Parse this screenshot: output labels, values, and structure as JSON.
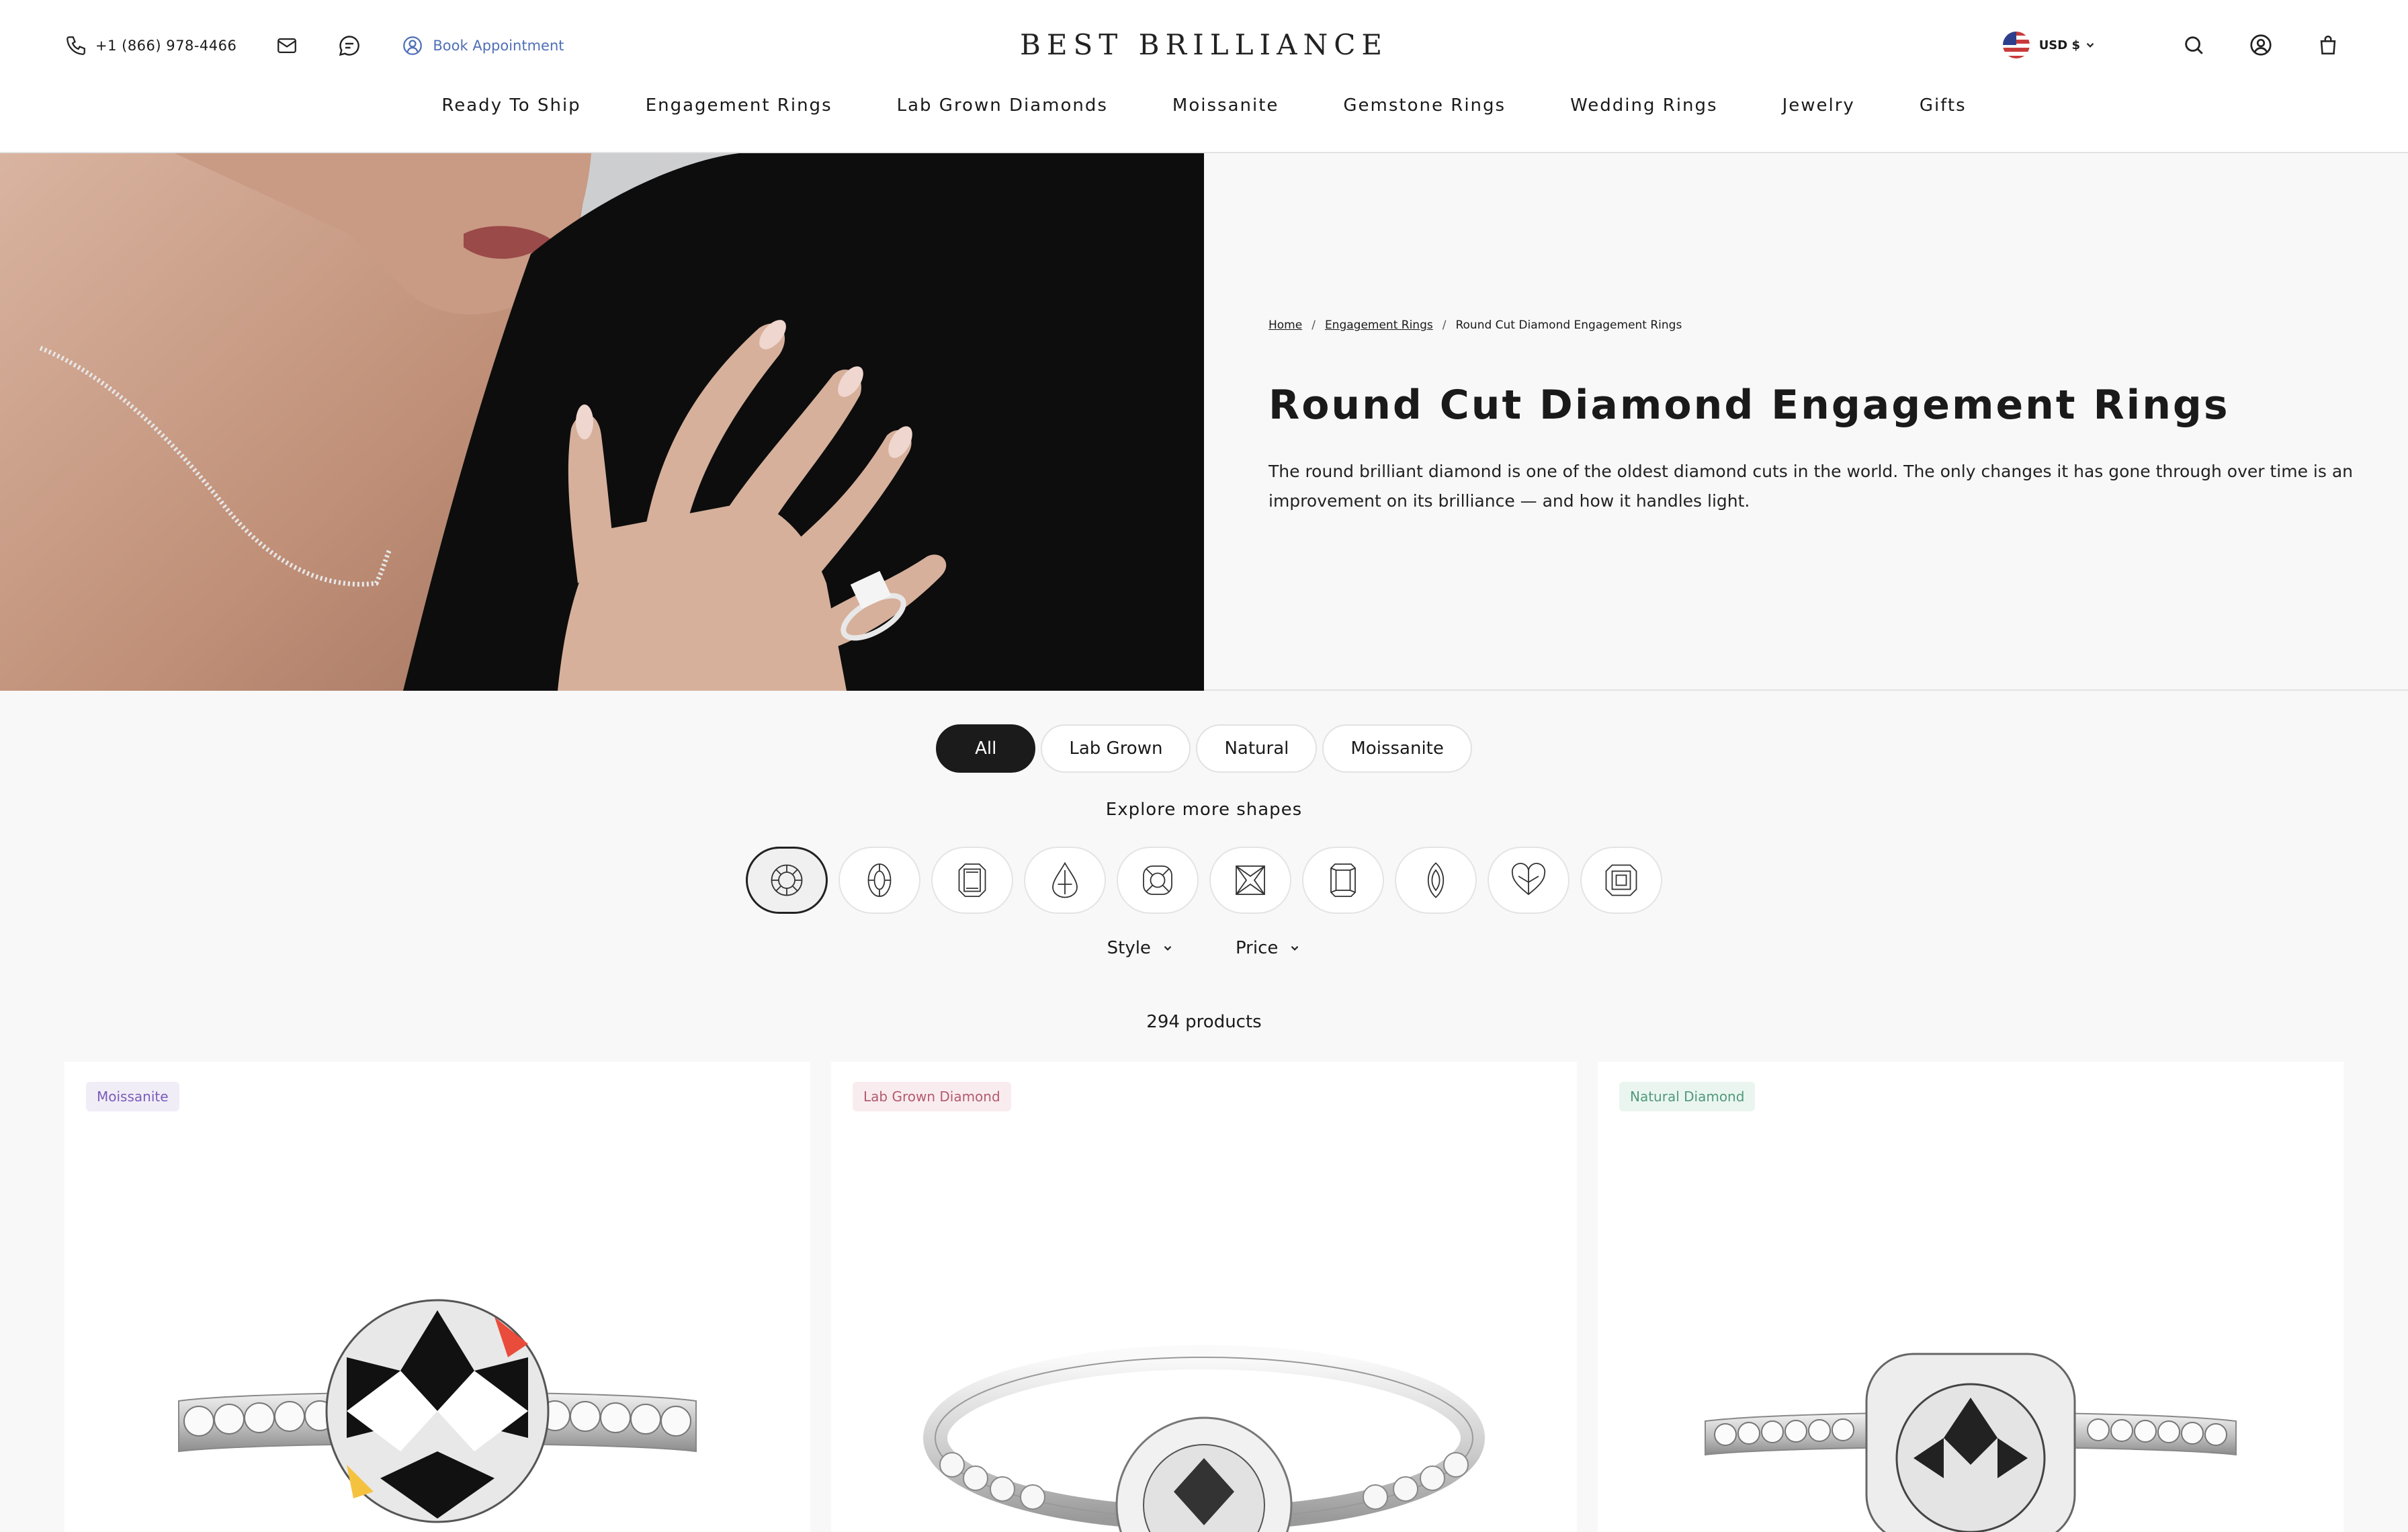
{
  "header": {
    "phone": "+1 (866) 978-4466",
    "book_appointment": "Book Appointment",
    "logo": "BEST BRILLIANCE",
    "currency": "USD $",
    "icons": [
      "phone-icon",
      "mail-icon",
      "chat-icon",
      "calendar-icon",
      "us-flag-icon",
      "chevron-down-icon",
      "search-icon",
      "account-icon",
      "bag-icon"
    ]
  },
  "nav": {
    "items": [
      "Ready To Ship",
      "Engagement Rings",
      "Lab Grown Diamonds",
      "Moissanite",
      "Gemstone Rings",
      "Wedding Rings",
      "Jewelry",
      "Gifts"
    ]
  },
  "hero": {
    "breadcrumb": [
      "Home",
      "Engagement Rings",
      "Round Cut Diamond Engagement Rings"
    ],
    "title": "Round Cut Diamond Engagement Rings",
    "description": "The round brilliant diamond is one of the oldest diamond cuts in the world. The only changes it has gone through over time is an improvement on its brilliance — and how it handles light."
  },
  "filters": {
    "tabs": [
      "All",
      "Lab Grown",
      "Natural",
      "Moissanite"
    ],
    "active_tab": "All",
    "shapes_title": "Explore more shapes",
    "shapes": [
      "round",
      "oval",
      "emerald",
      "pear",
      "cushion",
      "princess",
      "radiant",
      "marquise",
      "heart",
      "asscher"
    ],
    "active_shape": "round",
    "dropdowns": [
      "Style",
      "Price"
    ],
    "product_count": "294 products"
  },
  "products": [
    {
      "badge": "Moissanite",
      "badge_color": "#7a5cb8",
      "badge_bg": "#f1edf7"
    },
    {
      "badge": "Lab Grown Diamond",
      "badge_color": "#b35a6e",
      "badge_bg": "#f9ecef"
    },
    {
      "badge": "Natural Diamond",
      "badge_color": "#4f9a7a",
      "badge_bg": "#ebf5f0"
    }
  ],
  "colors": {
    "accent": "#4f6fb8",
    "dark": "#1b1b1b"
  }
}
